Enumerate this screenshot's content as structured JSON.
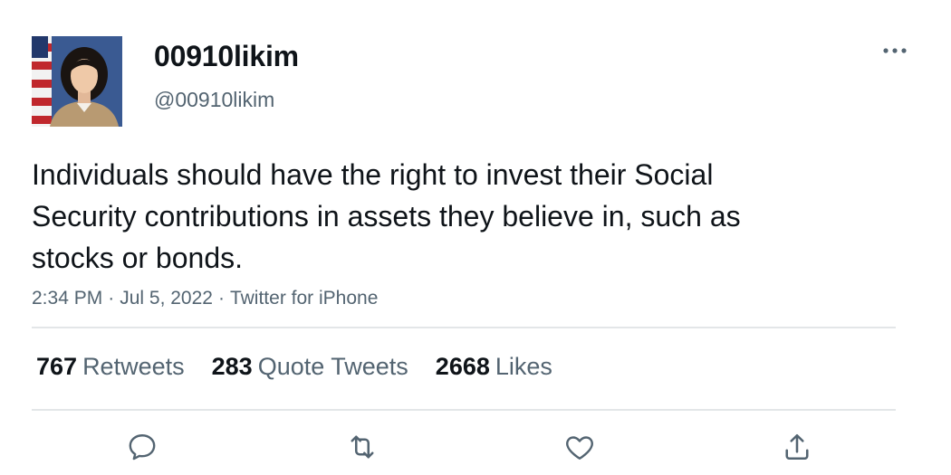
{
  "user": {
    "display_name": "00910likim",
    "handle": "@00910likim",
    "avatar_icon": "profile-photo"
  },
  "tweet": {
    "text": "Individuals should have the right to invest their Social Security contributions in assets they believe in, such as stocks or bonds.",
    "time": "2:34 PM",
    "date": "Jul 5, 2022",
    "source": "Twitter for iPhone"
  },
  "stats": {
    "retweets_count": "767",
    "retweets_label": "Retweets",
    "quotes_count": "283",
    "quotes_label": "Quote Tweets",
    "likes_count": "2668",
    "likes_label": "Likes"
  },
  "actions": {
    "reply_icon": "reply-icon",
    "retweet_icon": "retweet-icon",
    "like_icon": "heart-icon",
    "share_icon": "share-icon"
  },
  "colors": {
    "text_primary": "#0f1419",
    "text_secondary": "#536471",
    "divider": "#e3e6e8"
  }
}
